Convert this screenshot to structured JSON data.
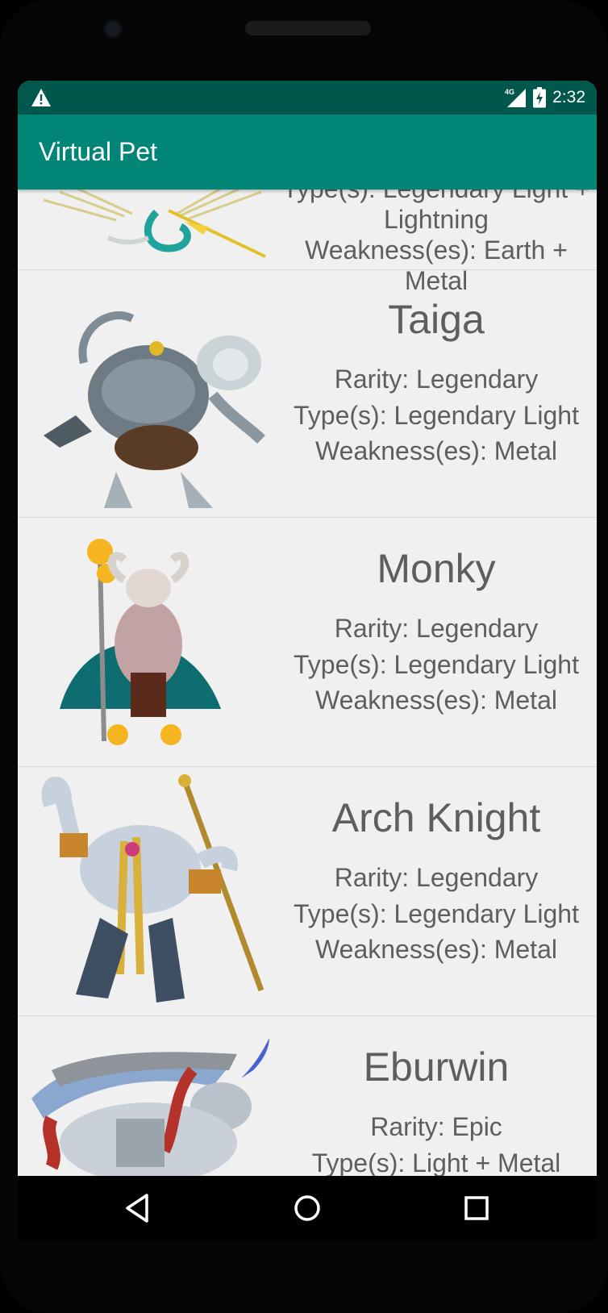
{
  "status_bar": {
    "network": "4G",
    "time": "2:32"
  },
  "app_bar": {
    "title": "Virtual Pet"
  },
  "partial_top": {
    "type_line": "Type(s): Legendary Light + Lightning",
    "weakness_line1": "Weakness(es): Earth +",
    "weakness_line2": "Metal"
  },
  "monsters": [
    {
      "name": "Taiga",
      "rarity": "Rarity: Legendary",
      "types": "Type(s): Legendary Light",
      "weakness": "Weakness(es): Metal"
    },
    {
      "name": "Monky",
      "rarity": "Rarity: Legendary",
      "types": "Type(s): Legendary Light",
      "weakness": "Weakness(es): Metal"
    },
    {
      "name": "Arch Knight",
      "rarity": "Rarity: Legendary",
      "types": "Type(s): Legendary Light",
      "weakness": "Weakness(es): Metal"
    },
    {
      "name": "Eburwin",
      "rarity": "Rarity: Epic",
      "types": "Type(s): Light + Metal"
    }
  ],
  "colors": {
    "status_bar": "#00574b",
    "app_bar": "#008577",
    "list_background": "#f0f0f0",
    "text": "#5e5e5e"
  },
  "icons": {
    "warning": "warning-icon",
    "signal": "signal-4g-icon",
    "battery": "battery-charging-icon",
    "back": "nav-back-icon",
    "home": "nav-home-icon",
    "recents": "nav-recents-icon"
  }
}
